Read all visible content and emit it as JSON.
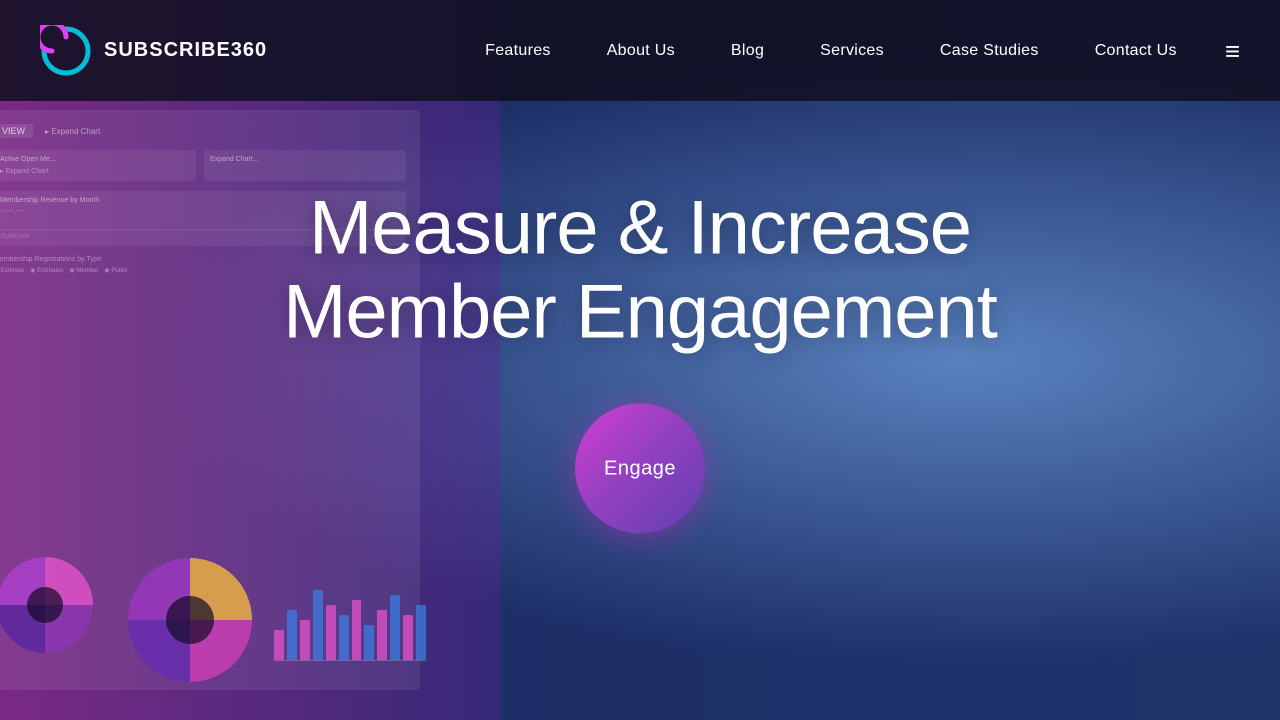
{
  "site": {
    "logo_text": "SUBSCRIBE360",
    "logo_aria": "Subscribe360 Logo"
  },
  "nav": {
    "items": [
      {
        "label": "Features",
        "id": "features"
      },
      {
        "label": "About Us",
        "id": "about"
      },
      {
        "label": "Blog",
        "id": "blog"
      },
      {
        "label": "Services",
        "id": "services"
      },
      {
        "label": "Case Studies",
        "id": "case-studies"
      },
      {
        "label": "Contact Us",
        "id": "contact"
      }
    ]
  },
  "hero": {
    "headline_line1": "Measure & Increase",
    "headline_line2": "Member Engagement",
    "cta_label": "Engage"
  },
  "colors": {
    "brand_cyan": "#00bcd4",
    "brand_magenta": "#e040fb",
    "cta_from": "#d040d0",
    "cta_to": "#6040b0"
  },
  "hamburger": {
    "icon_label": "≡"
  }
}
